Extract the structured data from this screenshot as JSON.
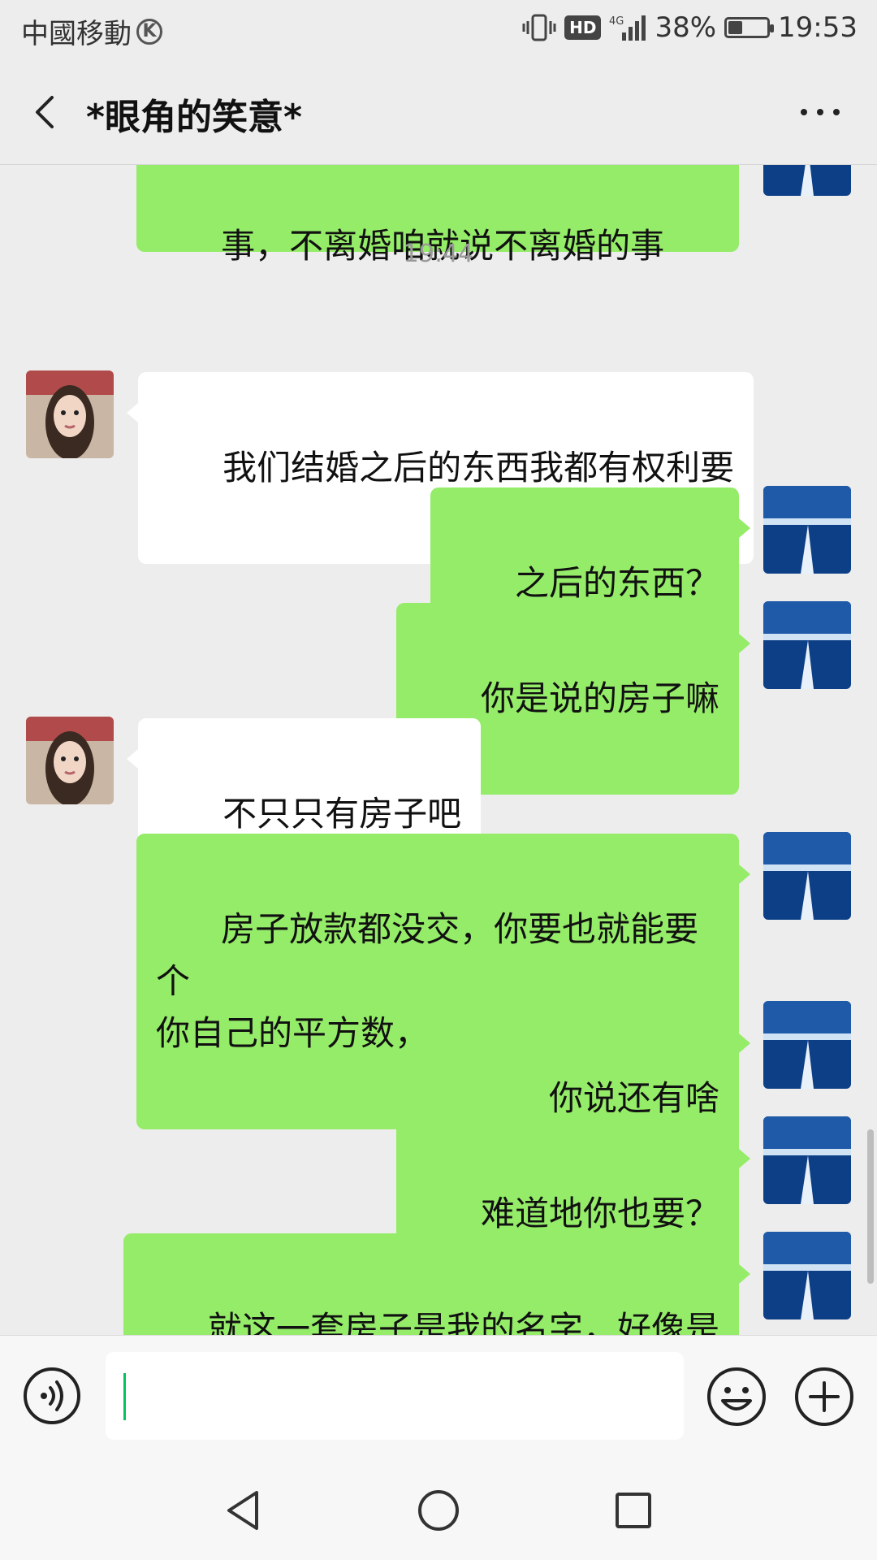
{
  "status_bar": {
    "carrier": "中國移動",
    "carrier_badge": "K",
    "network": "4G",
    "hd_label": "HD",
    "battery": "38%",
    "battery_level": 0.38,
    "time": "19:53"
  },
  "header": {
    "title": "*眼角的笑意*"
  },
  "messages": [
    {
      "type": "text",
      "side": "self",
      "text": "事，不离婚咱就说不离婚的事"
    },
    {
      "type": "time",
      "text": "19:44"
    },
    {
      "type": "text",
      "side": "other",
      "text": "我们结婚之后的东西我都有权利要"
    },
    {
      "type": "text",
      "side": "self",
      "text": "之后的东西？"
    },
    {
      "type": "text",
      "side": "self",
      "text": "你是说的房子嘛"
    },
    {
      "type": "text",
      "side": "other",
      "text": "不只只有房子吧"
    },
    {
      "type": "text",
      "side": "self",
      "text": "房子放款都没交，你要也就能要个\n你自己的平方数，"
    },
    {
      "type": "text",
      "side": "self",
      "text": "你说还有啥"
    },
    {
      "type": "text",
      "side": "self",
      "text": "难道地你也要？"
    },
    {
      "type": "text",
      "side": "self",
      "text": "就这一套房子是我的名字，好像是"
    }
  ],
  "input_bar": {
    "value": ""
  },
  "icons": {
    "back": "back-arrow-icon",
    "more": "more-dots-icon",
    "voice": "voice-icon",
    "emoji": "emoji-icon",
    "plus": "plus-icon"
  }
}
